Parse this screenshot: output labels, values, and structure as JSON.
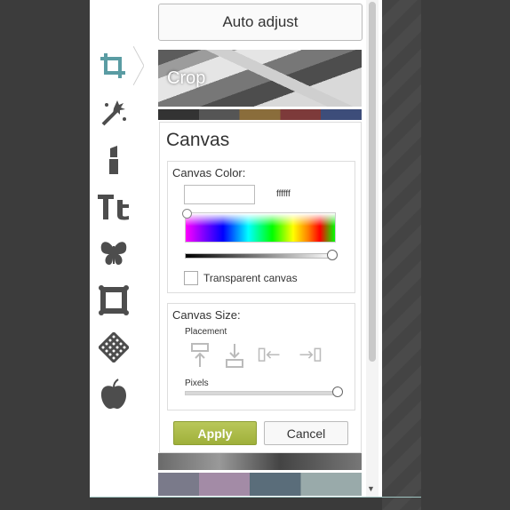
{
  "toolbar": {
    "tools": [
      {
        "name": "crop-icon",
        "active": true
      },
      {
        "name": "magic-wand-icon"
      },
      {
        "name": "lipstick-icon"
      },
      {
        "name": "text-icon",
        "glyph": "Tt"
      },
      {
        "name": "butterfly-icon"
      },
      {
        "name": "frame-icon"
      },
      {
        "name": "texture-icon"
      },
      {
        "name": "apple-icon"
      }
    ],
    "active_color": "#5a9ca3",
    "inactive_color": "#4d4d4d"
  },
  "panel": {
    "auto_adjust_label": "Auto adjust",
    "crop_label": "Crop"
  },
  "canvas": {
    "title": "Canvas",
    "color_label": "Canvas Color:",
    "hex_input_value": "",
    "hex_display": "ffffff",
    "transparent_label": "Transparent canvas",
    "transparent_checked": false,
    "size_label": "Canvas Size:",
    "placement_label": "Placement",
    "placement_options": [
      "place-top-icon",
      "place-bottom-icon",
      "place-left-icon",
      "place-right-icon"
    ],
    "pixels_label": "Pixels",
    "brightness_level": 1.0,
    "pixels_level": 1.0
  },
  "buttons": {
    "apply": "Apply",
    "cancel": "Cancel"
  },
  "colors": {
    "apply_button": "#a7b845",
    "bottom_accent": "#9fc3c0"
  }
}
